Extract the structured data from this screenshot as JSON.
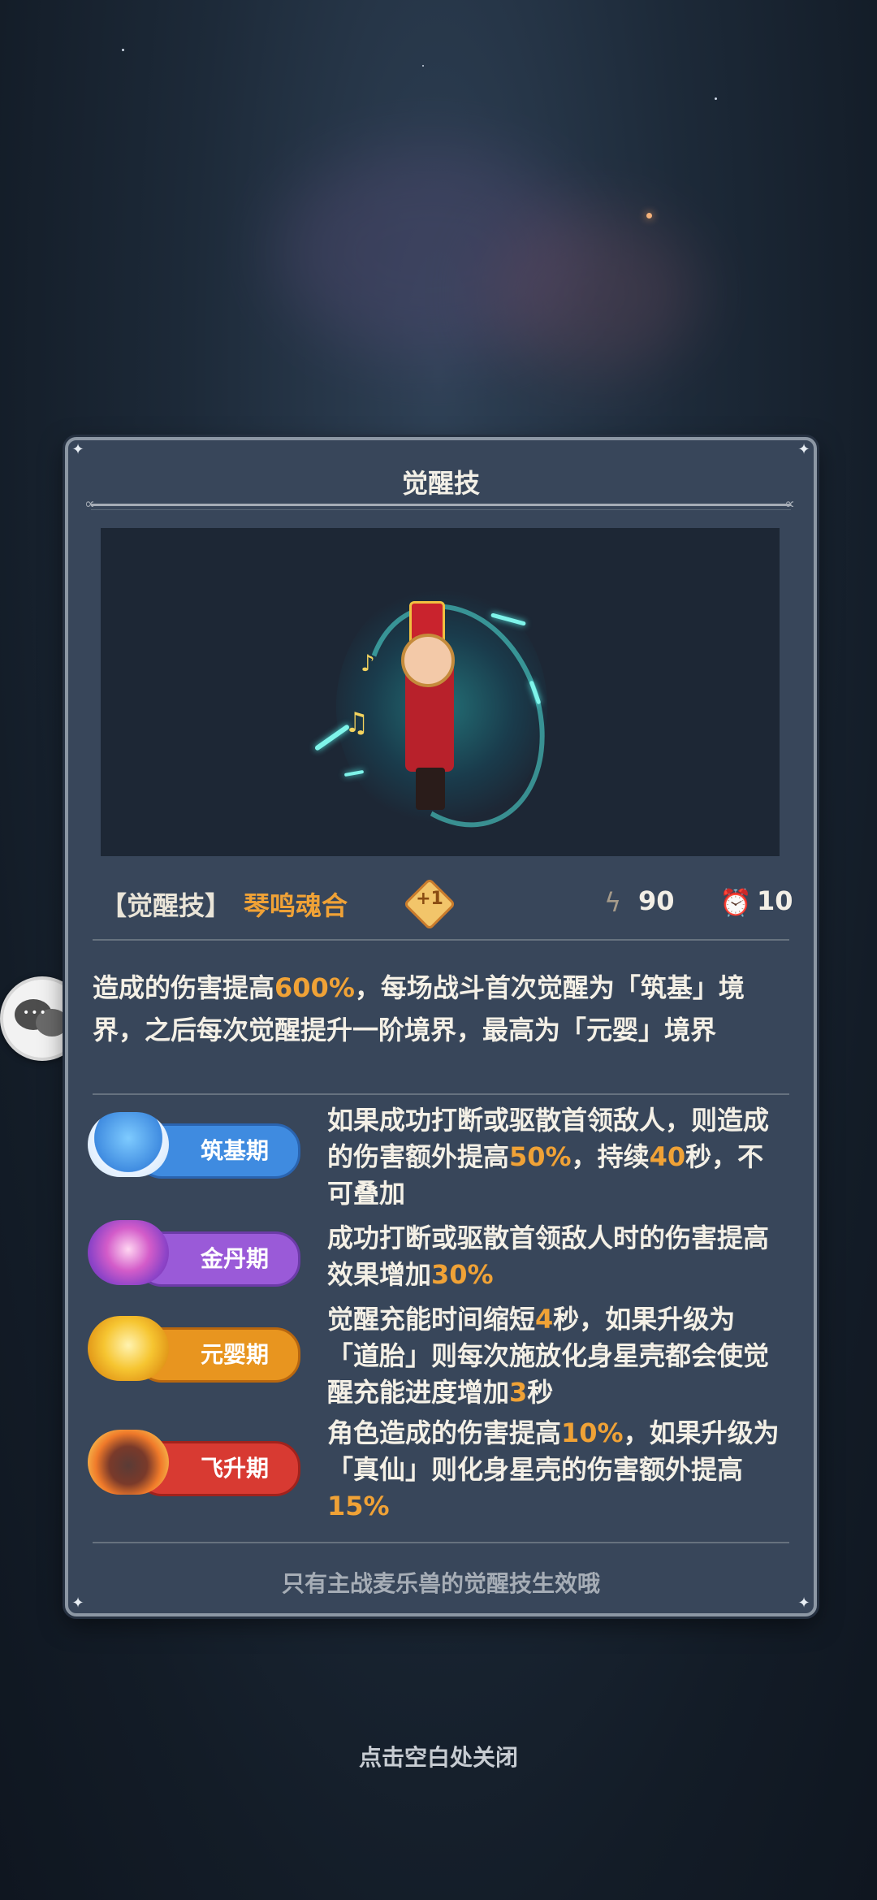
{
  "panel": {
    "title": "觉醒技"
  },
  "skill": {
    "prefix": "【觉醒技】",
    "name": "琴鸣魂合",
    "level_badge": "+1",
    "energy_icon": "lightning-icon",
    "energy": "90",
    "cooldown_icon": "alarm-clock-icon",
    "cooldown": "10"
  },
  "description": {
    "part1": "造成的伤害提高",
    "value1": "600%",
    "part2": "，每场战斗首次觉醒为「筑基」境界，之后每次觉醒提升一阶境界，最高为「元婴」境界"
  },
  "realms": [
    {
      "label": "筑基期",
      "color": "#3f8be0",
      "icon": "pavilion-cloud-icon",
      "text_a": "如果成功打断或驱散首领敌人，则造成的伤害额外提高",
      "val_a": "50%",
      "text_b": "，持续",
      "val_b": "40",
      "text_c": "秒，不可叠加"
    },
    {
      "label": "金丹期",
      "color": "#9a5ad8",
      "icon": "golden-orb-icon",
      "text_a": "成功打断或驱散首领敌人时的伤害提高效果增加",
      "val_a": "30%",
      "text_b": "",
      "val_b": "",
      "text_c": ""
    },
    {
      "label": "元婴期",
      "color": "#e8951f",
      "icon": "lotus-icon",
      "text_a": "觉醒充能时间缩短",
      "val_a": "4",
      "text_b": "秒，如果升级为「道胎」则每次施放化身星壳都会使觉醒充能进度增加",
      "val_b": "3",
      "text_c": "秒"
    },
    {
      "label": "飞升期",
      "color": "#d83a32",
      "icon": "flame-mountain-icon",
      "text_a": "角色造成的伤害提高",
      "val_a": "10%",
      "text_b": "，如果升级为「真仙」则化身星壳的伤害额外提高",
      "val_b": "15%",
      "text_c": ""
    }
  ],
  "footnote": "只有主战麦乐兽的觉醒技生效哦",
  "close_hint": "点击空白处关闭"
}
